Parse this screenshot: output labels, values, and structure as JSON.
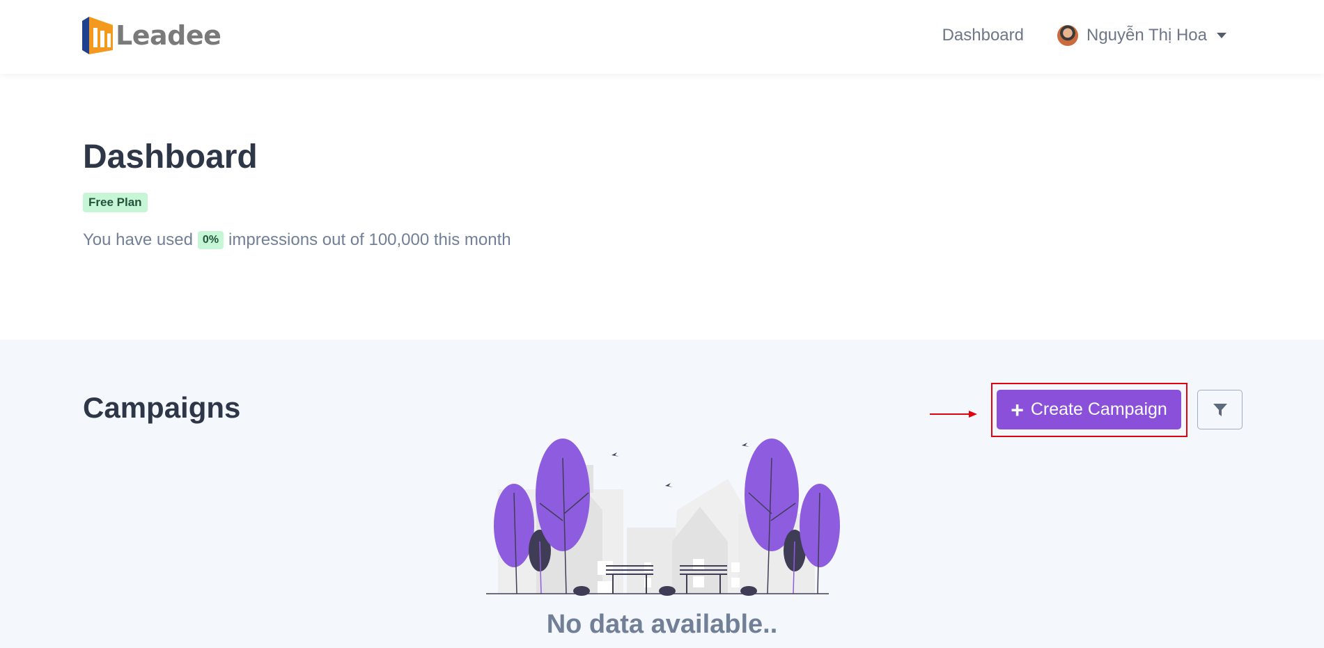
{
  "brand": {
    "name": "Leadee"
  },
  "nav": {
    "dashboard_link": "Dashboard",
    "user_name": "Nguyễn Thị Hoa"
  },
  "hero": {
    "title": "Dashboard",
    "plan_badge": "Free Plan",
    "usage_prefix": "You have used",
    "usage_percent": "0%",
    "usage_suffix": "impressions out of 100,000 this month"
  },
  "campaigns": {
    "title": "Campaigns",
    "create_button": "Create Campaign",
    "empty_text": "No data available.."
  },
  "icons": [
    "leadee-logo-icon",
    "avatar",
    "chevron-down-icon",
    "plus-icon",
    "filter-icon",
    "arrow-right-icon"
  ],
  "colors": {
    "accent": "#8a50d9",
    "badge_bg": "#c6f6d5",
    "badge_text": "#22543d",
    "section_bg": "#f4f7fc",
    "highlight": "#e3000f"
  }
}
